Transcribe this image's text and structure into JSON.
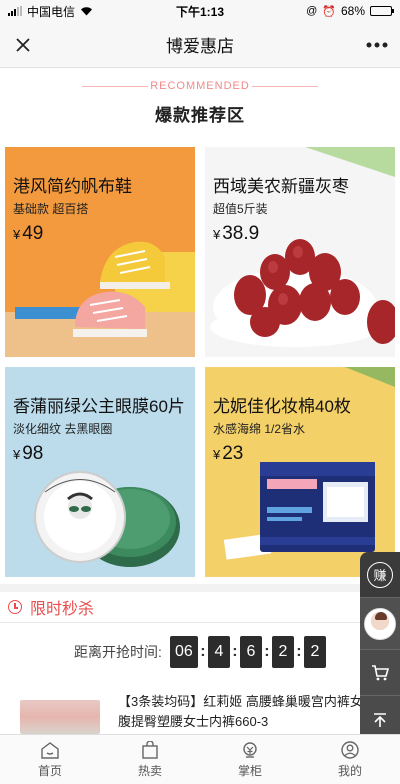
{
  "status_bar": {
    "carrier": "中国电信",
    "time": "下午1:13",
    "battery": "68%",
    "battery_level": 0.68
  },
  "nav": {
    "title": "博爱惠店",
    "close_icon": "close-icon",
    "more_icon": "more-dots-icon"
  },
  "recommended": {
    "en_label": "RECOMMENDED",
    "cn_title": "爆款推荐区"
  },
  "products": [
    {
      "name": "港风简约帆布鞋",
      "sub": "基础款  超百搭",
      "currency": "¥",
      "price": "49",
      "bg": "#f39a3e"
    },
    {
      "name": "西域美农新疆灰枣",
      "sub": "超值5斤装",
      "currency": "¥",
      "price": "38.9",
      "bg": "#f5f5f5"
    },
    {
      "name": "香蒲丽绿公主眼膜60片",
      "sub": "淡化细纹  去黑眼圈",
      "currency": "¥",
      "price": "98",
      "bg": "#bcdcec"
    },
    {
      "name": "尤妮佳化妆棉40枚",
      "sub": "水感海绵  1/2省水",
      "currency": "¥",
      "price": "23",
      "bg": "#f4d068"
    }
  ],
  "seckill": {
    "title": "限时秒杀",
    "countdown_label": "距离开抢时间:",
    "hours": "06",
    "min_tens": "4",
    "min_ones": "6",
    "sec_tens": "2",
    "sec_ones": "2"
  },
  "flash_product": {
    "title": "【3条装均码】红莉姬 高腰蜂巢暖宫内裤女无缝收腹提臀塑腰女士内裤660-3"
  },
  "side_buttons": {
    "earn_label": "赚"
  },
  "tabs": [
    {
      "label": "首页",
      "icon": "home-icon"
    },
    {
      "label": "热卖",
      "icon": "shopping-bag-icon"
    },
    {
      "label": "掌柜",
      "icon": "shopkeeper-icon"
    },
    {
      "label": "我的",
      "icon": "user-icon"
    }
  ]
}
